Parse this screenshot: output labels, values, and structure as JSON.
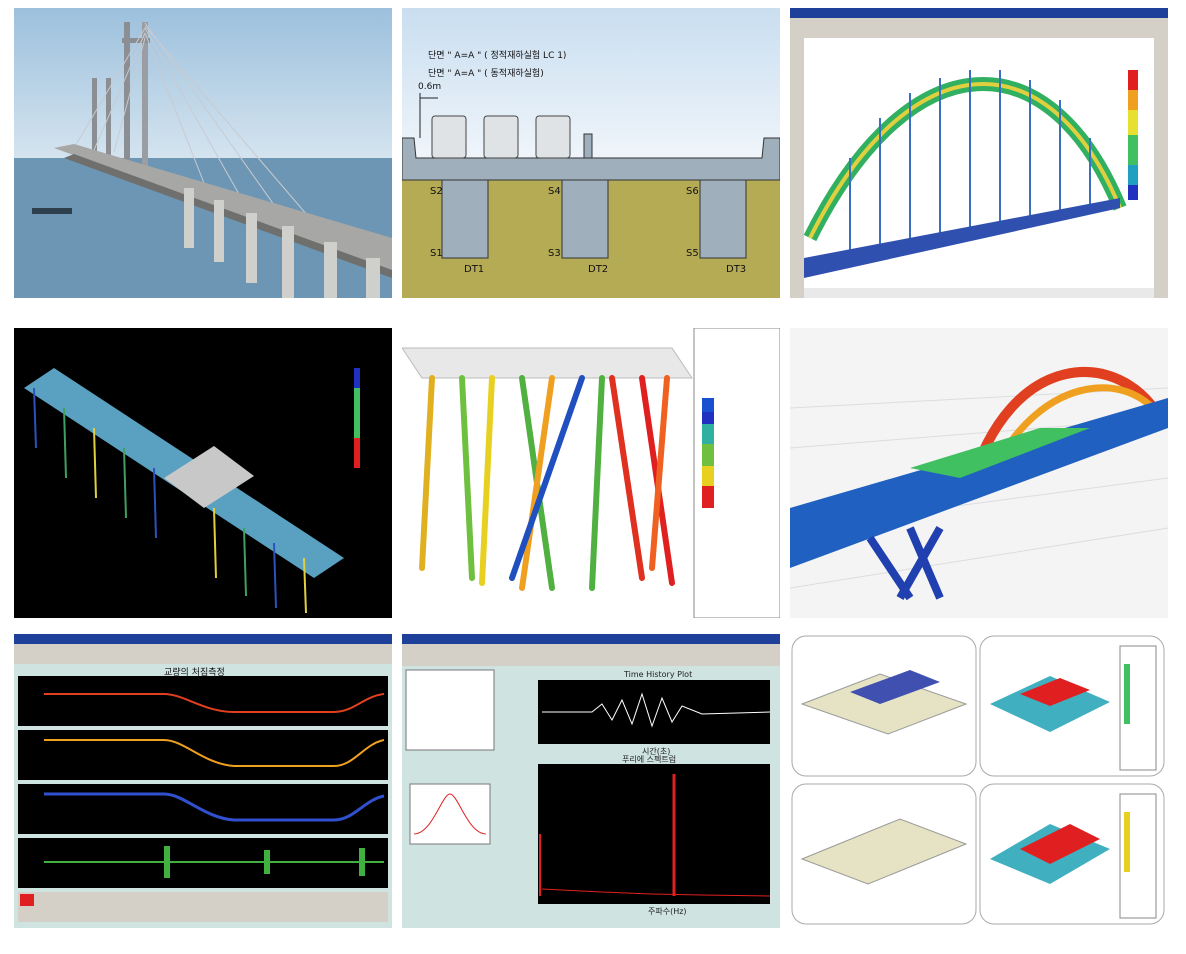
{
  "section": {
    "label_aa_static": "단면 \" A=A \" ( 정적재하실험 LC 1)",
    "label_aa_dynamic": "단면 \" A=A \" ( 동적재하실험)",
    "dim_label": "0.6m",
    "sensors": [
      "S1",
      "S2",
      "S3",
      "S4",
      "S5",
      "S6"
    ],
    "dt_labels": [
      "DT1",
      "DT2",
      "DT3"
    ]
  },
  "monitor_left": {
    "title": "교량의 처짐측정"
  },
  "monitor_right": {
    "top_plot_title": "Time History Plot",
    "xlabel": "시간(초)",
    "bottom_plot_title": "푸리에 스펙트럼",
    "bottom_xlabel": "주파수(Hz)"
  },
  "colors": {
    "sky": "#b9d3e8",
    "sea": "#5f8fb0",
    "legend_red": "#e02020",
    "legend_blue": "#2030c0",
    "monitor_bg": "#cfe3e0",
    "plot_black": "#000000"
  }
}
